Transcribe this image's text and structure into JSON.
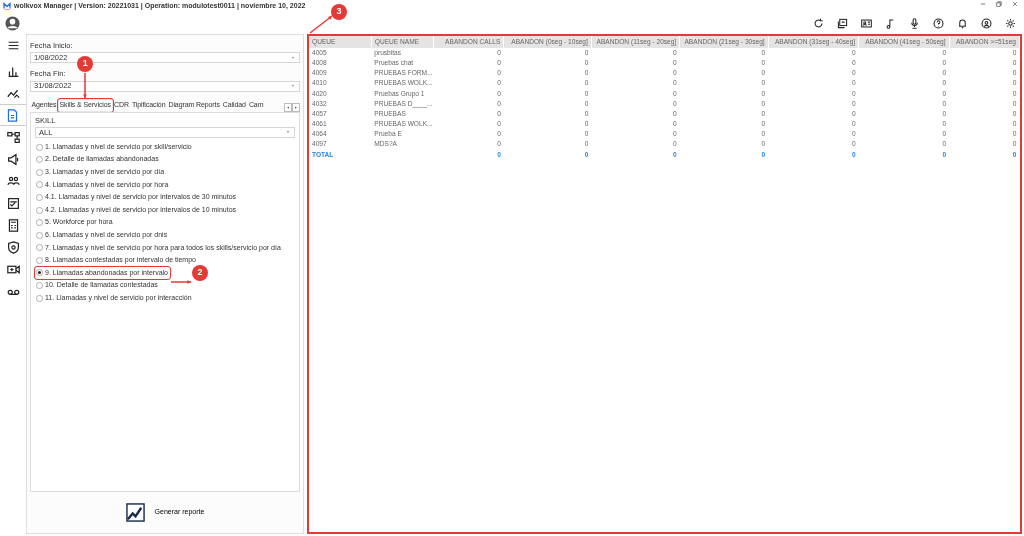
{
  "title_bar": {
    "text": "wolkvox Manager  | Version: 20221031 |  Operation: modulotest0011 | noviembre 10, 2022"
  },
  "sidebar": {
    "items": [
      {
        "kind": "menu",
        "selected": false
      },
      {
        "kind": "bars",
        "selected": false
      },
      {
        "kind": "analytics",
        "selected": false
      },
      {
        "kind": "report",
        "selected": true
      },
      {
        "kind": "flow",
        "selected": false
      },
      {
        "kind": "campaign",
        "selected": false
      },
      {
        "kind": "users",
        "selected": false
      },
      {
        "kind": "form",
        "selected": false
      },
      {
        "kind": "calculator",
        "selected": false
      },
      {
        "kind": "shield",
        "selected": false
      },
      {
        "kind": "video",
        "selected": false
      },
      {
        "kind": "voicemail",
        "selected": false
      }
    ]
  },
  "filters": {
    "start": {
      "label": "Fecha Inicio:",
      "value": "1/08/2022"
    },
    "end": {
      "label": "Fecha Fin:",
      "value": "31/08/2022"
    }
  },
  "tabs": [
    {
      "label": "Agentes",
      "selected": false,
      "highlighted": false
    },
    {
      "label": "Skills & Servicios",
      "selected": true,
      "highlighted": true
    },
    {
      "label": "CDR",
      "selected": false,
      "highlighted": false
    },
    {
      "label": "Tipificación",
      "selected": false,
      "highlighted": false
    },
    {
      "label": "Diagram Reports",
      "selected": false,
      "highlighted": false
    },
    {
      "label": "Calidad",
      "selected": false,
      "highlighted": false
    },
    {
      "label": "Cam",
      "selected": false,
      "highlighted": false
    }
  ],
  "skill": {
    "label": "SKILL",
    "value": "ALL"
  },
  "reports": [
    {
      "label": "1. Llamadas y nivel de servicio por skill/servicio",
      "selected": false,
      "highlighted": false
    },
    {
      "label": "2. Detalle de llamadas abandonadas",
      "selected": false,
      "highlighted": false
    },
    {
      "label": "3. Llamadas y nivel de servicio por día",
      "selected": false,
      "highlighted": false
    },
    {
      "label": "4. Llamadas y nivel de servicio por hora",
      "selected": false,
      "highlighted": false
    },
    {
      "label": "4.1. Llamadas y nivel de servicio por intervalos de 30 minutos",
      "selected": false,
      "highlighted": false
    },
    {
      "label": "4.2. Llamadas y nivel de servicio por intervalos de 10 minutos",
      "selected": false,
      "highlighted": false
    },
    {
      "label": "5. Workforce por hora",
      "selected": false,
      "highlighted": false
    },
    {
      "label": "6. Llamadas y nivel de servicio por dnis",
      "selected": false,
      "highlighted": false
    },
    {
      "label": "7. Llamadas y nivel de servicio por hora para todos los skills/servicio por día",
      "selected": false,
      "highlighted": false
    },
    {
      "label": "8. Llamadas contestadas por intervalo de tiempo",
      "selected": false,
      "highlighted": false
    },
    {
      "label": "9. Llamadas abandonadas por intervalo",
      "selected": true,
      "highlighted": true
    },
    {
      "label": "10. Detalle de llamadas contestadas",
      "selected": false,
      "highlighted": false
    },
    {
      "label": "11. Llamadas y nivel de servicio por interacción",
      "selected": false,
      "highlighted": false
    }
  ],
  "generate_button": {
    "label": "Generar reporte"
  },
  "table": {
    "highlighted": true,
    "columns": [
      "QUEUE",
      "QUEUE NAME",
      "ABANDON CALLS",
      "ABANDON (0seg - 10seg]",
      "ABANDON (11seg - 20seg]",
      "ABANDON (21seg - 30seg]",
      "ABANDON (31seg - 40seg]",
      "ABANDON (41seg - 50seg]",
      "ABANDON >=51seg"
    ],
    "rows": [
      [
        "4005",
        "prusbitas",
        "0",
        "0",
        "0",
        "0",
        "0",
        "0",
        "0"
      ],
      [
        "4008",
        "Pruebas chat",
        "0",
        "0",
        "0",
        "0",
        "0",
        "0",
        "0"
      ],
      [
        "4009",
        "PRUEBAS FORM...",
        "0",
        "0",
        "0",
        "0",
        "0",
        "0",
        "0"
      ],
      [
        "4010",
        "PRUEBAS WOLK...",
        "0",
        "0",
        "0",
        "0",
        "0",
        "0",
        "0"
      ],
      [
        "4020",
        "Pruebas Grupo 1",
        "0",
        "0",
        "0",
        "0",
        "0",
        "0",
        "0"
      ],
      [
        "4032",
        "PRUEBAS D____...",
        "0",
        "0",
        "0",
        "0",
        "0",
        "0",
        "0"
      ],
      [
        "4057",
        "PRUEBAS",
        "0",
        "0",
        "0",
        "0",
        "0",
        "0",
        "0"
      ],
      [
        "4061",
        "PRUEBAS WOLK...",
        "0",
        "0",
        "0",
        "0",
        "0",
        "0",
        "0"
      ],
      [
        "4064",
        "Prueba E",
        "0",
        "0",
        "0",
        "0",
        "0",
        "0",
        "0"
      ],
      [
        "4097",
        "MDS?A",
        "0",
        "0",
        "0",
        "0",
        "0",
        "0",
        "0"
      ]
    ],
    "total": {
      "label": "TOTAL",
      "values": [
        "0",
        "0",
        "0",
        "0",
        "0",
        "0",
        "0"
      ]
    }
  },
  "annotations": [
    {
      "label": "1"
    },
    {
      "label": "2"
    },
    {
      "label": "3"
    }
  ]
}
